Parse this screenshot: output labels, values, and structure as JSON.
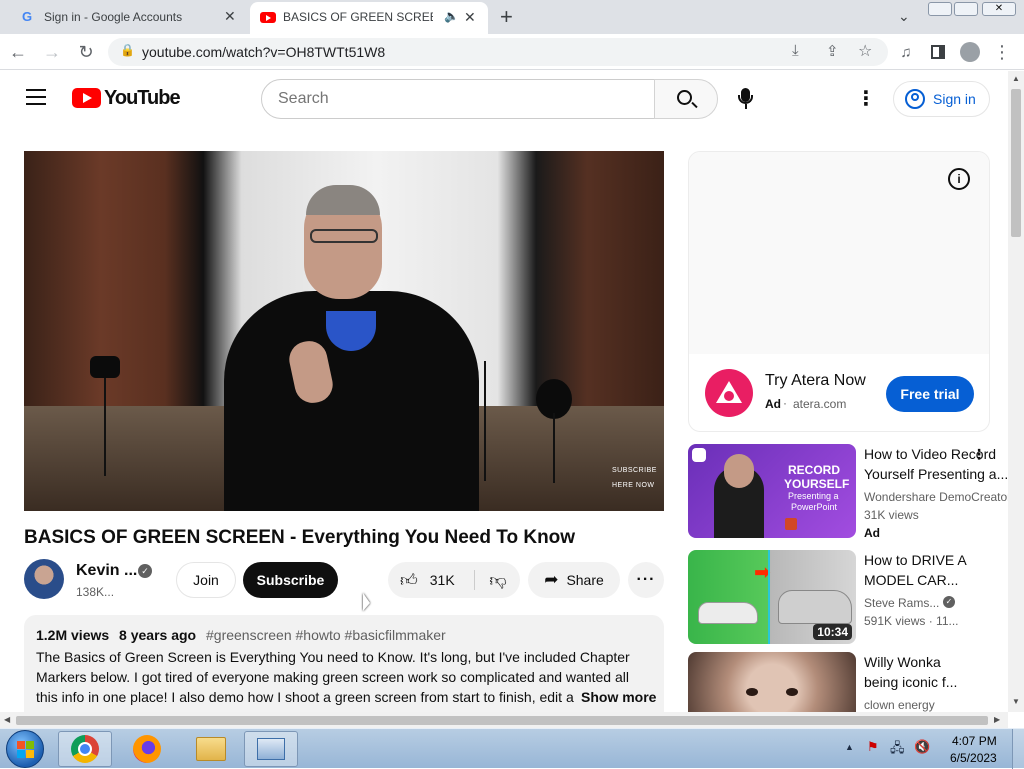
{
  "browser": {
    "tabs": [
      {
        "title": "Sign in - Google Accounts",
        "active": false
      },
      {
        "title": "BASICS OF GREEN SCREEN -",
        "active": true
      }
    ],
    "new_tab_label": "+",
    "url": "youtube.com/watch?v=OH8TWTt51W8"
  },
  "youtube": {
    "logo_text": "YouTube",
    "search_placeholder": "Search",
    "sign_in_label": "Sign in"
  },
  "video": {
    "title": "BASICS OF GREEN SCREEN - Everything You Need To Know",
    "overlay_text_1": "SUBSCRIBE",
    "overlay_text_2": "HERE NOW",
    "channel_name": "Kevin ...",
    "subscribers": "138K...",
    "join_label": "Join",
    "subscribe_label": "Subscribe",
    "likes": "31K",
    "share_label": "Share"
  },
  "description": {
    "views": "1.2M views",
    "age": "8 years ago",
    "hashtags": "#greenscreen #howto #basicfilmmaker",
    "line1": "The Basics of Green Screen is Everything You need to Know. It's long, but I've included Chapter",
    "line2": "Markers below. I got tired of everyone making green screen work so complicated and wanted all",
    "line3": "this info in one place!  I also demo how I shoot a green screen from start to finish, edit a",
    "show_more": "Show more"
  },
  "ad": {
    "title": "Try Atera Now",
    "ad_label": "Ad",
    "domain": "atera.com",
    "cta": "Free trial"
  },
  "recommendations": [
    {
      "title1": "How to Video Record",
      "title2": "Yourself Presenting a...",
      "channel": "Wondershare DemoCreator",
      "meta": "31K views",
      "badge": "Ad",
      "thumb_text1": "RECORD",
      "thumb_text2": "YOURSELF",
      "thumb_text3": "Presenting a",
      "thumb_text4": "PowerPoint"
    },
    {
      "title1": "How to DRIVE A",
      "title2": "MODEL CAR...",
      "channel": "Steve Rams...",
      "meta": "591K views · 11...",
      "duration": "10:34"
    },
    {
      "title1": "Willy Wonka",
      "title2": "being iconic f...",
      "channel": "clown energy"
    }
  ],
  "taskbar": {
    "time": "4:07 PM",
    "date": "6/5/2023"
  }
}
